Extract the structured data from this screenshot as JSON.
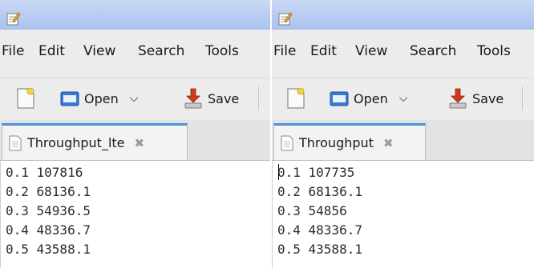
{
  "windows": [
    {
      "menu": [
        "File",
        "Edit",
        "View",
        "Search",
        "Tools"
      ],
      "toolbar": {
        "open_label": "Open",
        "save_label": "Save"
      },
      "tab": {
        "label": "Throughput_lte",
        "close": "✖"
      },
      "lines": [
        "0.1 107816",
        "0.2 68136.1",
        "0.3 54936.5",
        "0.4 48336.7",
        "0.5 43588.1"
      ]
    },
    {
      "menu": [
        "File",
        "Edit",
        "View",
        "Search",
        "Tools"
      ],
      "toolbar": {
        "open_label": "Open",
        "save_label": "Save"
      },
      "tab": {
        "label": "Throughput",
        "close": "✖"
      },
      "lines": [
        "0.1 107735",
        "0.2 68136.1",
        "0.3 54856",
        "0.4 48336.7",
        "0.5 43588.1"
      ]
    }
  ],
  "colors": {
    "titlebar": "#b3c8ef",
    "tab_accent": "#4a90d9",
    "save_icon": "#d23a1a",
    "open_icon": "#3a7bd5"
  },
  "icons": {
    "app": "text-editor-icon",
    "new": "new-document-icon",
    "open": "folder-open-icon",
    "save": "save-download-icon",
    "tab": "document-icon"
  }
}
